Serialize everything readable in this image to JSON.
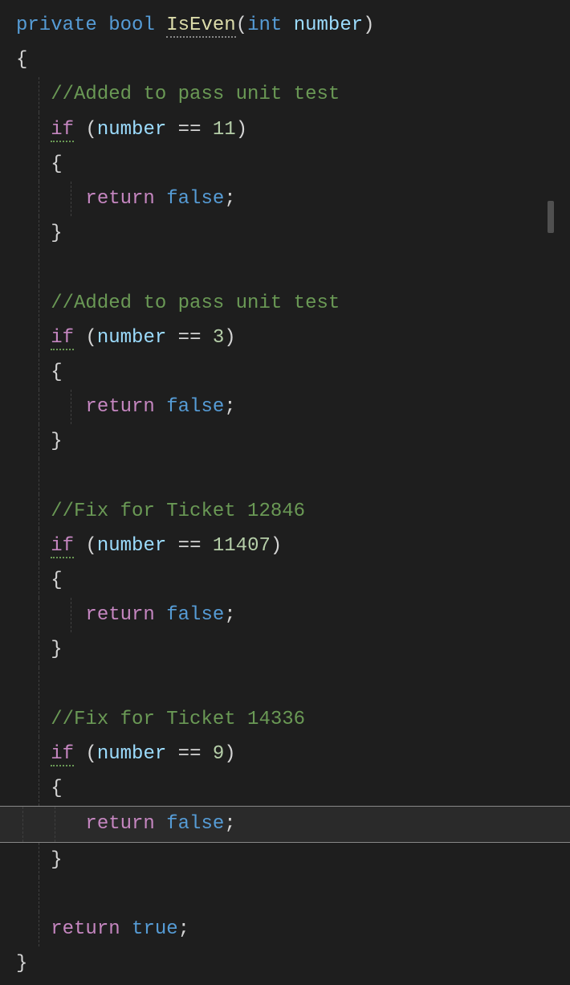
{
  "code": {
    "line1": {
      "private": "private",
      "bool": "bool",
      "methodName": "IsEven",
      "openParen": "(",
      "int": "int",
      "param": "number",
      "closeParen": ")"
    },
    "openBrace": "{",
    "closeBrace": "}",
    "comment1": "//Added to pass unit test",
    "comment2": "//Added to pass unit test",
    "comment3": "//Fix for Ticket 12846",
    "comment4": "//Fix for Ticket 14336",
    "ifKeyword": "if",
    "openParenIf": " (",
    "paramName": "number",
    "equals": " == ",
    "num11": "11",
    "num3": "3",
    "num11407": "11407",
    "num9": "9",
    "closeParenIf": ")",
    "returnKeyword": "return",
    "falseLiteral": "false",
    "trueLiteral": "true",
    "semicolon": ";"
  }
}
